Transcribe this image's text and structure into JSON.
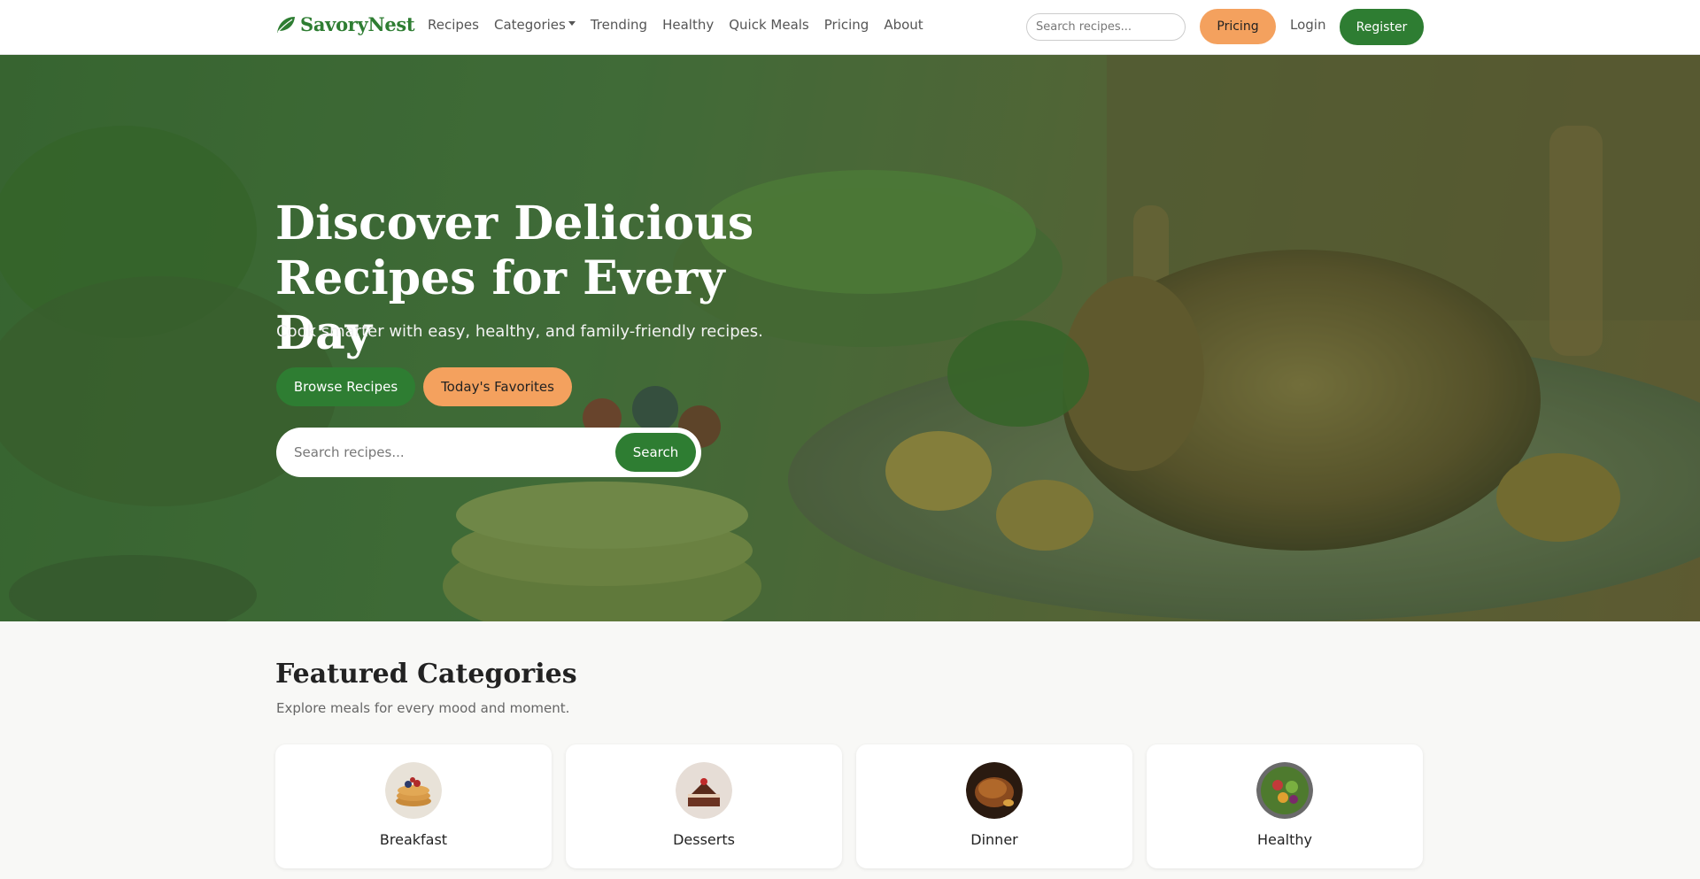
{
  "navbar": {
    "brand": "SavoryNest",
    "links": [
      {
        "label": "Recipes"
      },
      {
        "label": "Categories",
        "dropdown": true
      },
      {
        "label": "Trending"
      },
      {
        "label": "Healthy"
      },
      {
        "label": "Quick Meals"
      },
      {
        "label": "Pricing"
      },
      {
        "label": "About"
      }
    ],
    "search_placeholder": "Search recipes...",
    "pricing_label": "Pricing",
    "login_label": "Login",
    "register_label": "Register"
  },
  "hero": {
    "title_line1": "Discover Delicious",
    "title_line2": "Recipes for Every Day",
    "subtitle": "Cook smarter with easy, healthy, and family-friendly recipes.",
    "browse_label": "Browse Recipes",
    "favorites_label": "Today's Favorites",
    "search_placeholder": "Search recipes...",
    "search_button": "Search"
  },
  "featured": {
    "title": "Featured Categories",
    "subtitle": "Explore meals for every mood and moment.",
    "categories": [
      {
        "label": "Breakfast",
        "icon": "pancakes-image"
      },
      {
        "label": "Desserts",
        "icon": "cake-image"
      },
      {
        "label": "Dinner",
        "icon": "roast-chicken-image"
      },
      {
        "label": "Healthy",
        "icon": "salad-bowl-image"
      }
    ]
  },
  "colors": {
    "primary": "#2e7d32",
    "accent": "#f4a15e",
    "background": "#f8f8f6"
  }
}
